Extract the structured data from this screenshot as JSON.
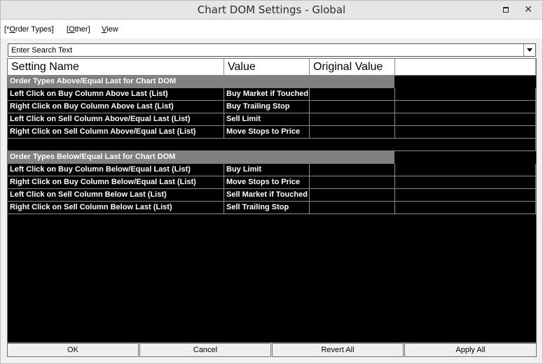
{
  "window": {
    "title": "Chart DOM Settings - Global"
  },
  "menu": {
    "items": [
      {
        "prefix": "[*",
        "accel": "O",
        "rest": "rder Types]"
      },
      {
        "prefix": "[",
        "accel": "O",
        "rest": "ther]"
      },
      {
        "prefix": "",
        "accel": "V",
        "rest": "iew"
      }
    ]
  },
  "search": {
    "value": "Enter Search Text"
  },
  "grid": {
    "columns": [
      "Setting Name",
      "Value",
      "Original Value",
      ""
    ],
    "groups": [
      {
        "title": "Order Types Above/Equal Last for Chart DOM",
        "rows": [
          {
            "name": "Left Click on Buy Column Above Last (List)",
            "value": "Buy Market if Touched",
            "original": ""
          },
          {
            "name": "Right Click on Buy Column Above Last (List)",
            "value": "Buy Trailing Stop",
            "original": ""
          },
          {
            "name": "Left Click on Sell Column Above/Equal Last (List)",
            "value": "Sell Limit",
            "original": ""
          },
          {
            "name": "Right Click on Sell Column Above/Equal Last (List)",
            "value": "Move Stops to Price",
            "original": ""
          }
        ]
      },
      {
        "title": "Order Types Below/Equal Last for Chart DOM",
        "rows": [
          {
            "name": "Left Click on Buy Column Below/Equal Last (List)",
            "value": "Buy Limit",
            "original": ""
          },
          {
            "name": "Right Click on Buy Column Below/Equal Last (List)",
            "value": "Move Stops to Price",
            "original": ""
          },
          {
            "name": "Left Click on Sell Column Below Last (List)",
            "value": "Sell Market if Touched",
            "original": ""
          },
          {
            "name": "Right Click on Sell Column Below Last (List)",
            "value": "Sell Trailing Stop",
            "original": ""
          }
        ]
      }
    ]
  },
  "buttons": {
    "ok": "OK",
    "cancel": "Cancel",
    "revert": "Revert All",
    "apply": "Apply All"
  }
}
